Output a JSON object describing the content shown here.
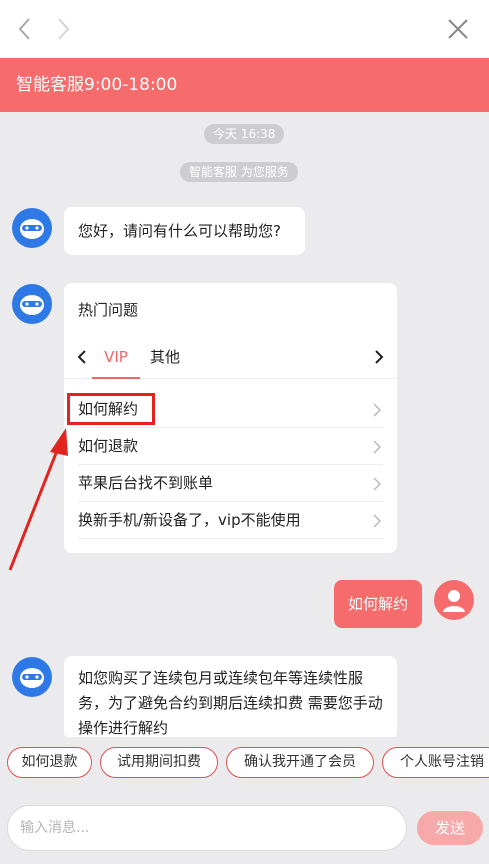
{
  "banner": {
    "title": "智能客服9:00-18:00"
  },
  "chat": {
    "timestamp": "今天 16:38",
    "service_notice": "智能客服 为您服务",
    "greeting": "您好，请问有什么可以帮助您?",
    "hot_questions": {
      "title": "热门问题",
      "tabs": [
        "VIP",
        "其他"
      ],
      "active_tab": "VIP",
      "items": [
        "如何解约",
        "如何退款",
        "苹果后台找不到账单",
        "换新手机/新设备了，vip不能使用"
      ]
    },
    "user_message": "如何解约",
    "answer": "如您购买了连续包月或连续包年等连续性服务，为了避免合约到期后连续扣费 需要您手动操作进行解约"
  },
  "quick_replies": [
    "如何退款",
    "试用期间扣费",
    "确认我开通了会员",
    "个人账号注销"
  ],
  "input": {
    "placeholder": "输入消息...",
    "value": ""
  },
  "send_button": {
    "label": "发送"
  },
  "colors": {
    "brand": "#f66b6b",
    "bot_avatar": "#2f79e6",
    "annotation": "#e2241f"
  },
  "icons": [
    "back-icon",
    "forward-icon",
    "close-icon",
    "bot-avatar-icon",
    "user-avatar-icon",
    "chevron-left-icon",
    "chevron-right-icon"
  ]
}
